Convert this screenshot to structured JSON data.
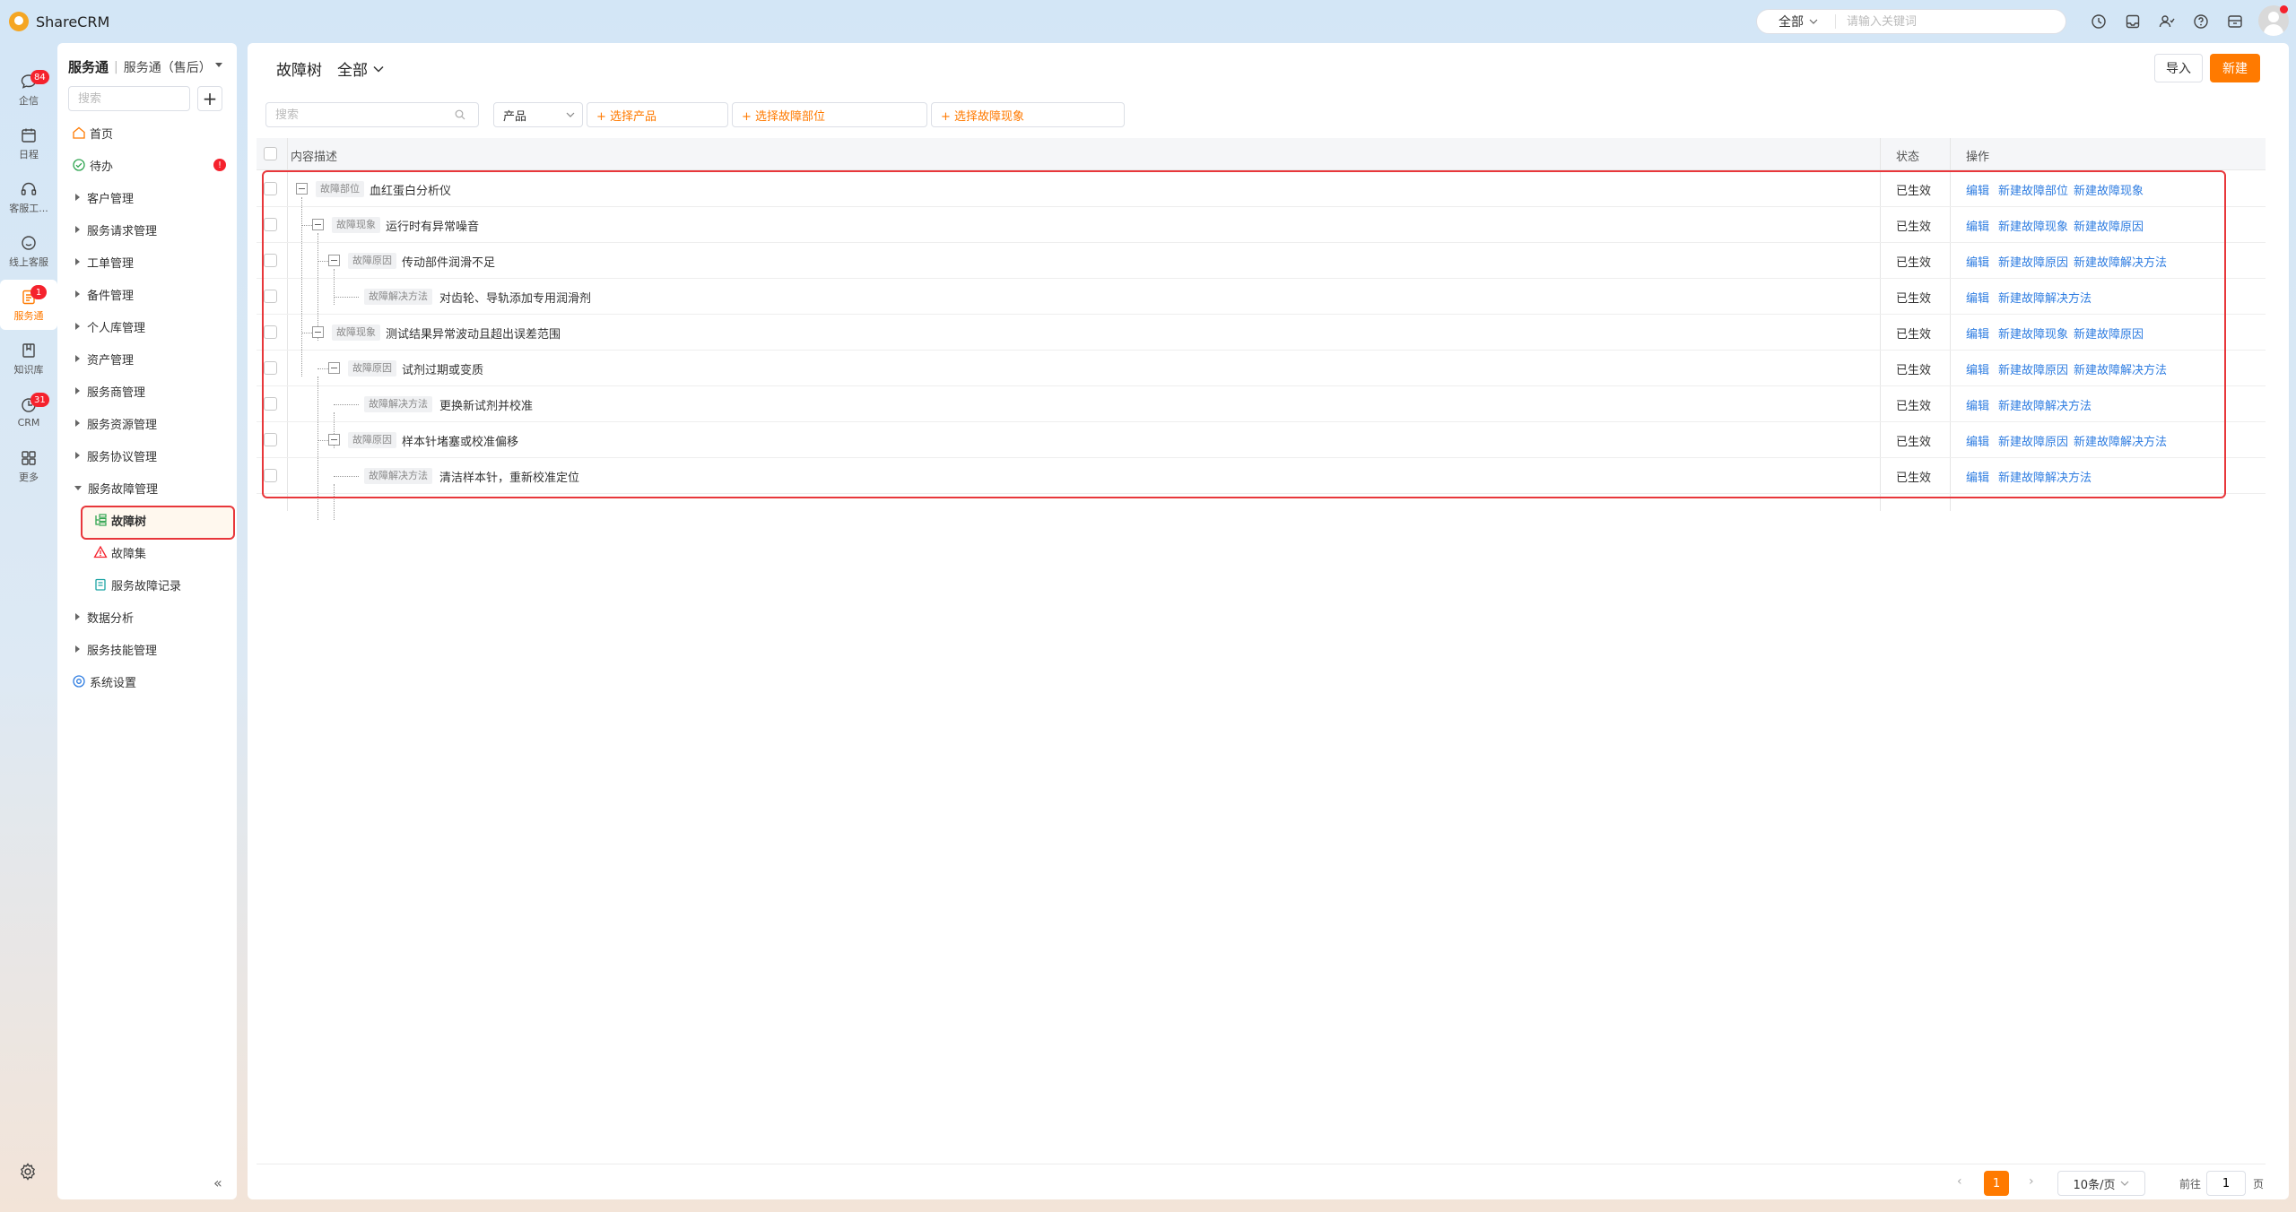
{
  "app": {
    "name": "ShareCRM"
  },
  "global_search": {
    "scope": "全部",
    "placeholder": "请输入关键词"
  },
  "rail": [
    {
      "label": "企信",
      "badge": "84"
    },
    {
      "label": "日程",
      "badge": ""
    },
    {
      "label": "客服工...",
      "badge": ""
    },
    {
      "label": "线上客服",
      "badge": ""
    },
    {
      "label": "服务通",
      "badge": "1"
    },
    {
      "label": "知识库",
      "badge": ""
    },
    {
      "label": "CRM",
      "badge": "31"
    },
    {
      "label": "更多",
      "badge": ""
    }
  ],
  "sidebar": {
    "title": "服务通",
    "subtitle": "服务通（售后）",
    "search_placeholder": "搜索",
    "items": [
      {
        "label": "首页"
      },
      {
        "label": "待办",
        "badge": "!"
      },
      {
        "label": "客户管理"
      },
      {
        "label": "服务请求管理"
      },
      {
        "label": "工单管理"
      },
      {
        "label": "备件管理"
      },
      {
        "label": "个人库管理"
      },
      {
        "label": "资产管理"
      },
      {
        "label": "服务商管理"
      },
      {
        "label": "服务资源管理"
      },
      {
        "label": "服务协议管理"
      },
      {
        "label": "服务故障管理"
      },
      {
        "label": "故障树"
      },
      {
        "label": "故障集"
      },
      {
        "label": "服务故障记录"
      },
      {
        "label": "数据分析"
      },
      {
        "label": "服务技能管理"
      },
      {
        "label": "系统设置"
      }
    ]
  },
  "page": {
    "title": "故障树",
    "scope": "全部",
    "import_label": "导入",
    "new_label": "新建"
  },
  "filters": {
    "search_placeholder": "搜索",
    "product_label": "产品",
    "select_product": "+ 选择产品",
    "select_part": "+ 选择故障部位",
    "select_phenomenon": "+ 选择故障现象"
  },
  "table": {
    "headers": {
      "desc": "内容描述",
      "status": "状态",
      "ops": "操作"
    },
    "rows": [
      {
        "tag": "故障部位",
        "desc": "血红蛋白分析仪",
        "status": "已生效",
        "ops": [
          "编辑",
          "新建故障部位",
          "新建故障现象"
        ]
      },
      {
        "tag": "故障现象",
        "desc": "运行时有异常噪音",
        "status": "已生效",
        "ops": [
          "编辑",
          "新建故障现象",
          "新建故障原因"
        ]
      },
      {
        "tag": "故障原因",
        "desc": "传动部件润滑不足",
        "status": "已生效",
        "ops": [
          "编辑",
          "新建故障原因",
          "新建故障解决方法"
        ]
      },
      {
        "tag": "故障解决方法",
        "desc": "对齿轮、导轨添加专用润滑剂",
        "status": "已生效",
        "ops": [
          "编辑",
          "新建故障解决方法"
        ]
      },
      {
        "tag": "故障现象",
        "desc": "测试结果异常波动且超出误差范围",
        "status": "已生效",
        "ops": [
          "编辑",
          "新建故障现象",
          "新建故障原因"
        ]
      },
      {
        "tag": "故障原因",
        "desc": "试剂过期或变质",
        "status": "已生效",
        "ops": [
          "编辑",
          "新建故障原因",
          "新建故障解决方法"
        ]
      },
      {
        "tag": "故障解决方法",
        "desc": "更换新试剂并校准",
        "status": "已生效",
        "ops": [
          "编辑",
          "新建故障解决方法"
        ]
      },
      {
        "tag": "故障原因",
        "desc": "样本针堵塞或校准偏移",
        "status": "已生效",
        "ops": [
          "编辑",
          "新建故障原因",
          "新建故障解决方法"
        ]
      },
      {
        "tag": "故障解决方法",
        "desc": "清洁样本针，重新校准定位",
        "status": "已生效",
        "ops": [
          "编辑",
          "新建故障解决方法"
        ]
      }
    ]
  },
  "pagination": {
    "current": "1",
    "page_size": "10条/页",
    "goto_label": "前往",
    "goto_value": "1",
    "page_suffix": "页"
  }
}
